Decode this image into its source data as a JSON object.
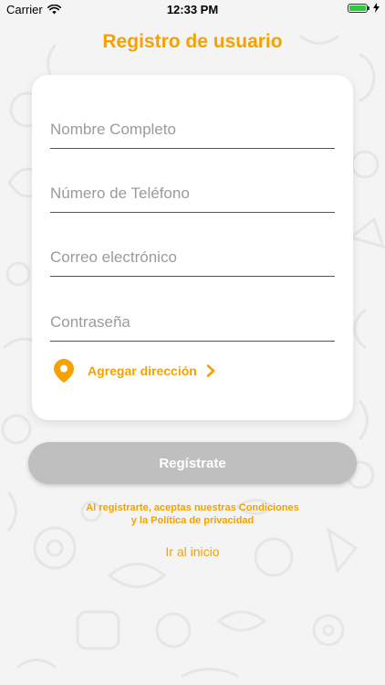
{
  "status_bar": {
    "carrier": "Carrier",
    "time": "12:33 PM",
    "battery_level": 1.0
  },
  "page": {
    "title": "Registro de usuario"
  },
  "form": {
    "full_name_placeholder": "Nombre Completo",
    "phone_placeholder": "Número de Teléfono",
    "email_placeholder": "Correo electrónico",
    "password_placeholder": "Contraseña",
    "address_label": "Agregar dirección"
  },
  "actions": {
    "register_label": "Regístrate",
    "terms_line_1": "Al registrarte, aceptas nuestras Condiciones",
    "terms_line_2": "y la Política de privacidad",
    "home_link": "Ir al inicio"
  },
  "colors": {
    "accent": "#f5a100",
    "button_disabled": "#bfbfbf",
    "background": "#f4f4f4"
  },
  "icons": {
    "wifi": "wifi-icon",
    "battery": "battery-icon",
    "charging": "charging-icon",
    "address": "location-pin-icon",
    "chevron": "chevron-right-icon"
  }
}
